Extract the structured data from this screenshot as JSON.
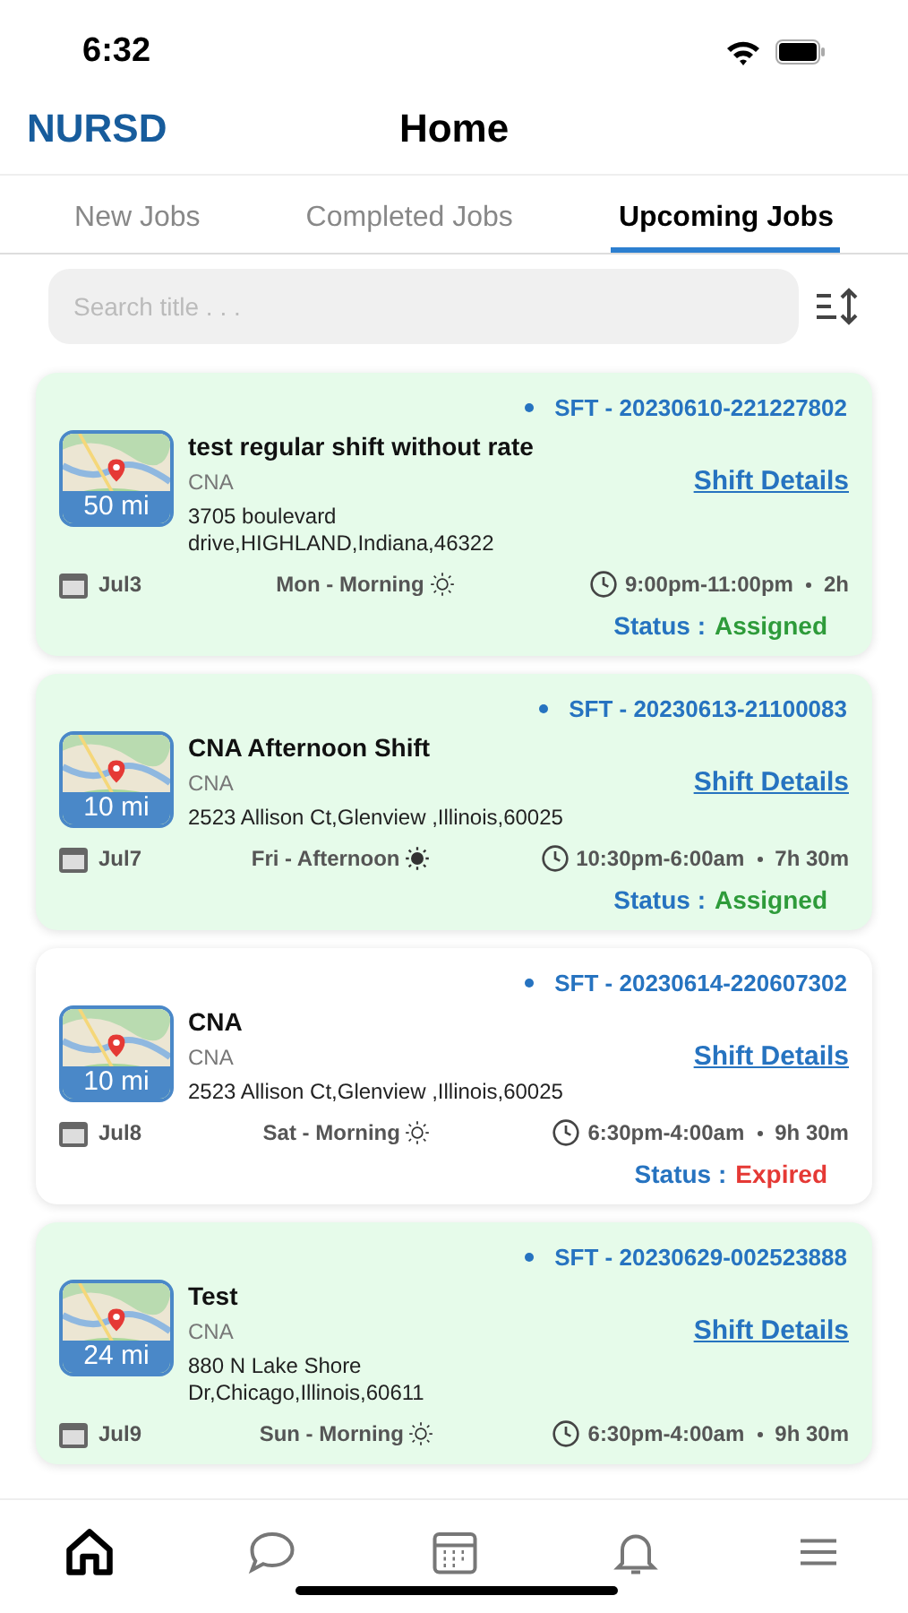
{
  "status_bar": {
    "time": "6:32"
  },
  "header": {
    "logo": "NURSD",
    "title": "Home"
  },
  "tabs": [
    {
      "label": "New Jobs",
      "selected": false
    },
    {
      "label": "Completed Jobs",
      "selected": false
    },
    {
      "label": "Upcoming Jobs",
      "selected": true
    }
  ],
  "search": {
    "placeholder": "Search title . . ."
  },
  "jobs": [
    {
      "code": "SFT - 20230610-221227802",
      "distance": "50 mi",
      "title": "test regular shift without rate",
      "role": "CNA",
      "address": "3705 boulevard drive,HIGHLAND,Indiana,46322",
      "link": "Shift Details",
      "date": "Jul3",
      "shift": "Mon - Morning",
      "sun_filled": false,
      "time": "9:00pm-11:00pm",
      "duration": "2h",
      "status_label": "Status :",
      "status": "Assigned",
      "expired": false
    },
    {
      "code": "SFT - 20230613-21100083",
      "distance": "10 mi",
      "title": "CNA Afternoon Shift",
      "role": "CNA",
      "address": "2523 Allison Ct,Glenview ,Illinois,60025",
      "link": "Shift Details",
      "date": "Jul7",
      "shift": "Fri - Afternoon",
      "sun_filled": true,
      "time": "10:30pm-6:00am",
      "duration": "7h 30m",
      "status_label": "Status :",
      "status": "Assigned",
      "expired": false
    },
    {
      "code": "SFT - 20230614-220607302",
      "distance": "10 mi",
      "title": "CNA",
      "role": "CNA",
      "address": "2523 Allison Ct,Glenview ,Illinois,60025",
      "link": "Shift Details",
      "date": "Jul8",
      "shift": "Sat - Morning",
      "sun_filled": false,
      "time": "6:30pm-4:00am",
      "duration": "9h 30m",
      "status_label": "Status :",
      "status": "Expired",
      "expired": true
    },
    {
      "code": "SFT - 20230629-002523888",
      "distance": "24 mi",
      "title": "Test",
      "role": "CNA",
      "address": "880 N Lake Shore Dr,Chicago,Illinois,60611",
      "link": "Shift Details",
      "date": "Jul9",
      "shift": "Sun - Morning",
      "sun_filled": false,
      "time": "6:30pm-4:00am",
      "duration": "9h 30m",
      "expired": false
    }
  ],
  "nav": [
    {
      "kind": "home",
      "selected": true
    },
    {
      "kind": "chat",
      "selected": false
    },
    {
      "kind": "calendar",
      "selected": false
    },
    {
      "kind": "bell",
      "selected": false
    },
    {
      "kind": "menu",
      "selected": false
    }
  ]
}
